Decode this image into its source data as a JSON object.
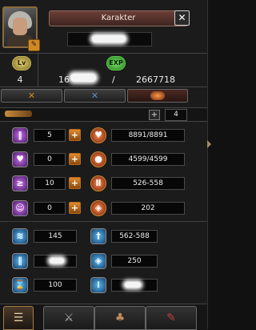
{
  "window": {
    "title": "Karakter",
    "close_glyph": "✕"
  },
  "portrait": {
    "edit_icon": "pencil-icon"
  },
  "level": {
    "badge": "Lv",
    "value": "4"
  },
  "exp": {
    "badge": "EXP",
    "current_visible": "16",
    "separator": "/",
    "max": "2667718"
  },
  "tabs": [
    {
      "icon": "crossed-swords-icon",
      "glyph": "✕"
    },
    {
      "icon": "blue-x-icon",
      "glyph": "✕"
    },
    {
      "icon": "orange-gem-icon"
    }
  ],
  "points": {
    "plus": "+",
    "value": "4"
  },
  "stats": [
    {
      "icon": "strength-icon",
      "value": "5",
      "right_icon": "heart-icon",
      "right_value": "8891/8891"
    },
    {
      "icon": "vitality-heart-icon",
      "value": "0",
      "right_icon": "mana-icon",
      "right_value": "4599/4599"
    },
    {
      "icon": "dexterity-icon",
      "value": "10",
      "right_icon": "attack-icon",
      "right_value": "526-558"
    },
    {
      "icon": "intelligence-icon",
      "value": "0",
      "right_icon": "defense-shield-icon",
      "right_value": "202"
    }
  ],
  "sub_stats": [
    {
      "icon": "move-speed-icon",
      "value": "145",
      "right_icon": "magic-attack-icon",
      "right_value": "562-588"
    },
    {
      "icon": "attack-speed-icon",
      "value": "",
      "right_icon": "magic-defense-icon",
      "right_value": "250"
    },
    {
      "icon": "cast-speed-icon",
      "value": "100",
      "right_icon": "dodge-icon",
      "right_value": ""
    }
  ],
  "plus_label": "+",
  "bottom_tabs": [
    {
      "icon": "character-card-icon",
      "glyph": "☰"
    },
    {
      "icon": "skills-sword-icon",
      "glyph": "⚔"
    },
    {
      "icon": "emotions-icon",
      "glyph": "♣"
    },
    {
      "icon": "quest-icon",
      "glyph": "✎"
    }
  ]
}
